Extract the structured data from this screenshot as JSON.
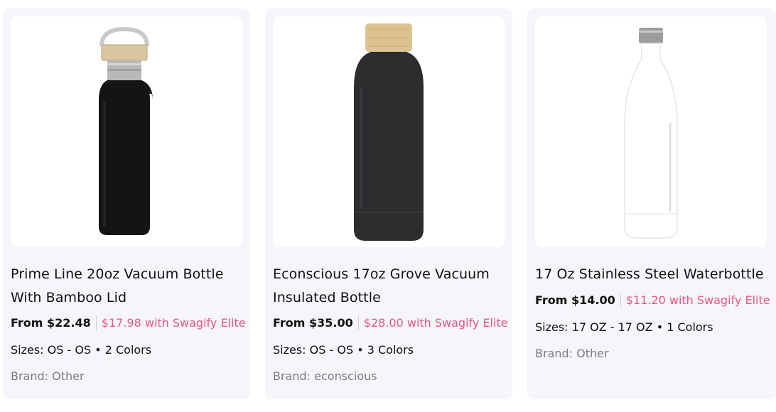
{
  "products": [
    {
      "title": "Prime Line 20oz Vacuum Bottle With Bamboo Lid",
      "price_from": "From $22.48",
      "elite_price": "$17.98 with Swagify Elite",
      "sizes": "Sizes: OS - OS • 2 Colors",
      "brand": "Brand: Other",
      "image_icon": "black-bottle-bamboo-handle-lid-image",
      "bottle_color": "#141414"
    },
    {
      "title": "Econscious 17oz Grove Vacuum Insulated Bottle",
      "price_from": "From $35.00",
      "elite_price": "$28.00 with Swagify Elite",
      "sizes": "Sizes: OS - OS • 3 Colors",
      "brand": "Brand: econscious",
      "image_icon": "dark-bottle-bamboo-cap-image",
      "bottle_color": "#2b2d2f"
    },
    {
      "title": "17 Oz Stainless Steel Waterbottle",
      "price_from": "From $14.00",
      "elite_price": "$11.20 with Swagify Elite",
      "sizes": "Sizes: 17 OZ - 17 OZ • 1 Colors",
      "brand": "Brand: Other",
      "image_icon": "white-bottle-steel-cap-image",
      "bottle_color": "#ffffff"
    }
  ],
  "colors": {
    "card_bg": "#f5f5fa",
    "elite_accent": "#e8577e",
    "brand_text": "#7a7a80"
  }
}
